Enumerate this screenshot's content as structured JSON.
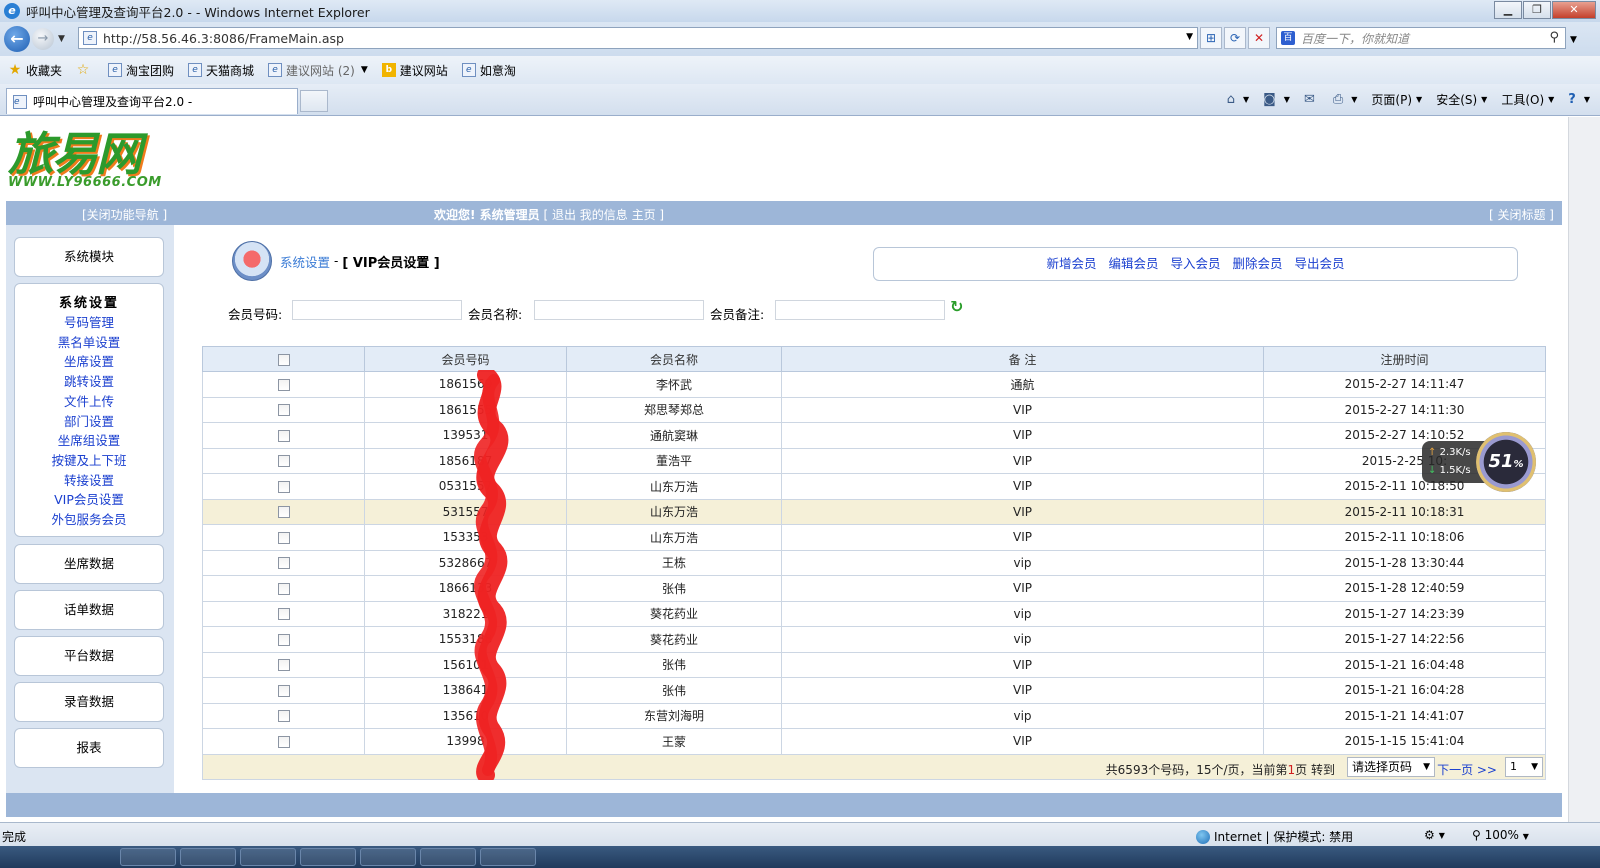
{
  "browser": {
    "window_title": "呼叫中心管理及查询平台2.0 -  - Windows Internet Explorer",
    "url": "http://58.56.46.3:8086/FrameMain.asp",
    "search_placeholder": "百度一下，你就知道",
    "favorites": [
      {
        "label": "收藏夹"
      },
      {
        "label": "淘宝团购"
      },
      {
        "label": "天猫商城"
      },
      {
        "label": "建议网站 (2)"
      },
      {
        "label": "建议网站"
      },
      {
        "label": "如意淘"
      }
    ],
    "tab_title": "呼叫中心管理及查询平台2.0 -",
    "commands": {
      "page": "页面(P)",
      "safety": "安全(S)",
      "tools": "工具(O)"
    },
    "status": {
      "done": "完成",
      "zone": "Internet | 保护模式: 禁用",
      "zoom": "100%"
    }
  },
  "site": {
    "logo_text": "旅易网",
    "logo_url_text": "WWW.LY96666.COM"
  },
  "topband": {
    "close_nav": "[关闭功能导航 ]",
    "welcome": "欢迎您! 系统管理员",
    "links": "[ 退出  我的信息  主页 ]",
    "close_title": "[ 关闭标题 ]"
  },
  "leftnav": {
    "modules": "系统模块",
    "settings_head": "系统设置",
    "settings_items": [
      "号码管理",
      "黑名单设置",
      "坐席设置",
      "跳转设置",
      "文件上传",
      "部门设置",
      "坐席组设置",
      "按键及上下班",
      "转接设置",
      "VIP会员设置",
      "外包服务会员"
    ],
    "seat_data": "坐席数据",
    "call_data": "话单数据",
    "platform_data": "平台数据",
    "record_data": "录音数据",
    "report": "报表"
  },
  "breadcrumb": {
    "parent": "系统设置",
    "separator": "-",
    "current": "[ VIP会员设置 ]"
  },
  "actions": {
    "add": "新增会员",
    "edit": "编辑会员",
    "import": "导入会员",
    "delete": "删除会员",
    "export": "导出会员"
  },
  "filters": {
    "number_label": "会员号码:",
    "name_label": "会员名称:",
    "note_label": "会员备注:"
  },
  "table": {
    "headers": {
      "number": "会员号码",
      "name": "会员名称",
      "note": "备 注",
      "time": "注册时间"
    },
    "rows": [
      {
        "number": "1861569",
        "name": "李怀武",
        "note": "通航",
        "time": "2015-2-27 14:11:47"
      },
      {
        "number": "1861555",
        "name": "郑思琴郑总",
        "note": "VIP",
        "time": "2015-2-27 14:11:30"
      },
      {
        "number": "139531",
        "name": "通航窦琳",
        "note": "VIP",
        "time": "2015-2-27 14:10:52"
      },
      {
        "number": "1856187",
        "name": "董浩平",
        "note": "VIP",
        "time": "2015-2-25 10:"
      },
      {
        "number": "0531557",
        "name": "山东万浩",
        "note": "VIP",
        "time": "2015-2-11 10:18:50"
      },
      {
        "number": "531557",
        "name": "山东万浩",
        "note": "VIP",
        "time": "2015-2-11 10:18:31"
      },
      {
        "number": "153353",
        "name": "山东万浩",
        "note": "VIP",
        "time": "2015-2-11 10:18:06"
      },
      {
        "number": "5328667",
        "name": "王栋",
        "note": "vip",
        "time": "2015-1-28 13:30:44"
      },
      {
        "number": "1866133",
        "name": "张伟",
        "note": "VIP",
        "time": "2015-1-28 12:40:59"
      },
      {
        "number": "318221",
        "name": "葵花药业",
        "note": "vip",
        "time": "2015-1-27 14:23:39"
      },
      {
        "number": "1553188",
        "name": "葵花药业",
        "note": "vip",
        "time": "2015-1-27 14:22:56"
      },
      {
        "number": "156101",
        "name": "张伟",
        "note": "VIP",
        "time": "2015-1-21 16:04:48"
      },
      {
        "number": "138641",
        "name": "张伟",
        "note": "VIP",
        "time": "2015-1-21 16:04:28"
      },
      {
        "number": "135610",
        "name": "东营刘海明",
        "note": "vip",
        "time": "2015-1-21 14:41:07"
      },
      {
        "number": "13998",
        "name": "王蒙",
        "note": "VIP",
        "time": "2015-1-15 15:41:04"
      }
    ]
  },
  "pager": {
    "info_prefix": "共6593个号码，15个/页，当前第",
    "current_page": "1",
    "info_suffix": "页  转到",
    "select_placeholder": "请选择页码",
    "next": "下一页 >>",
    "page_value": "1"
  },
  "speed_widget": {
    "up": "2.3K/s",
    "down": "1.5K/s",
    "percent": "51",
    "percent_sign": "%"
  }
}
